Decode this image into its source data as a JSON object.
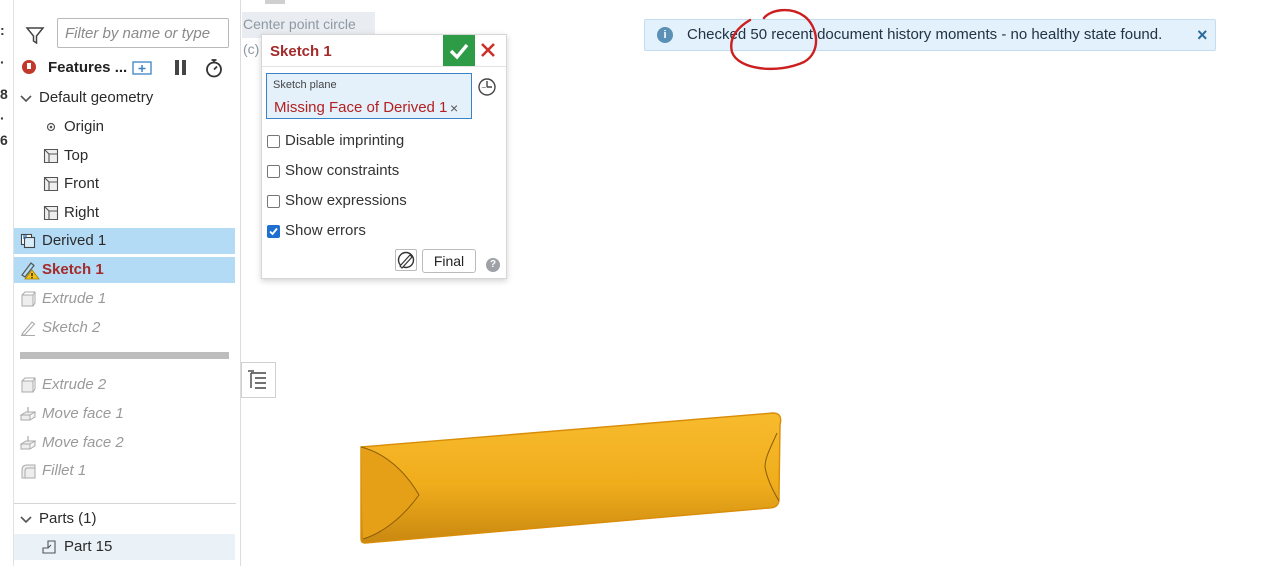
{
  "tooltip": "Center point circle (c)",
  "filter": {
    "placeholder": "Filter by name or type"
  },
  "features": {
    "label": "Features ..."
  },
  "tree": {
    "default_geometry": "Default geometry",
    "origin": "Origin",
    "top": "Top",
    "front": "Front",
    "right": "Right",
    "derived": "Derived 1",
    "sketch1": "Sketch 1",
    "extrude1": "Extrude 1",
    "sketch2": "Sketch 2",
    "extrude2": "Extrude 2",
    "moveface1": "Move face 1",
    "moveface2": "Move face 2",
    "fillet1": "Fillet 1"
  },
  "parts": {
    "header": "Parts (1)",
    "item": "Part 15"
  },
  "dialog": {
    "title": "Sketch 1",
    "plane_caption": "Sketch plane",
    "plane_value": "Missing Face of Derived 1",
    "remove": "×",
    "options": [
      {
        "label": "Disable imprinting",
        "checked": false
      },
      {
        "label": "Show constraints",
        "checked": false
      },
      {
        "label": "Show expressions",
        "checked": false
      },
      {
        "label": "Show errors",
        "checked": true
      }
    ],
    "final_label": "Final",
    "help": "?"
  },
  "notice": {
    "message": "Checked 50 recent document history moments - no healthy state found.",
    "close": "×",
    "info": "i"
  },
  "colors": {
    "part": "#f0ad1c",
    "error": "#a52a2a",
    "ok": "#2e9b47",
    "selection": "#b3dbf5",
    "annotation": "#cc1f1f"
  }
}
